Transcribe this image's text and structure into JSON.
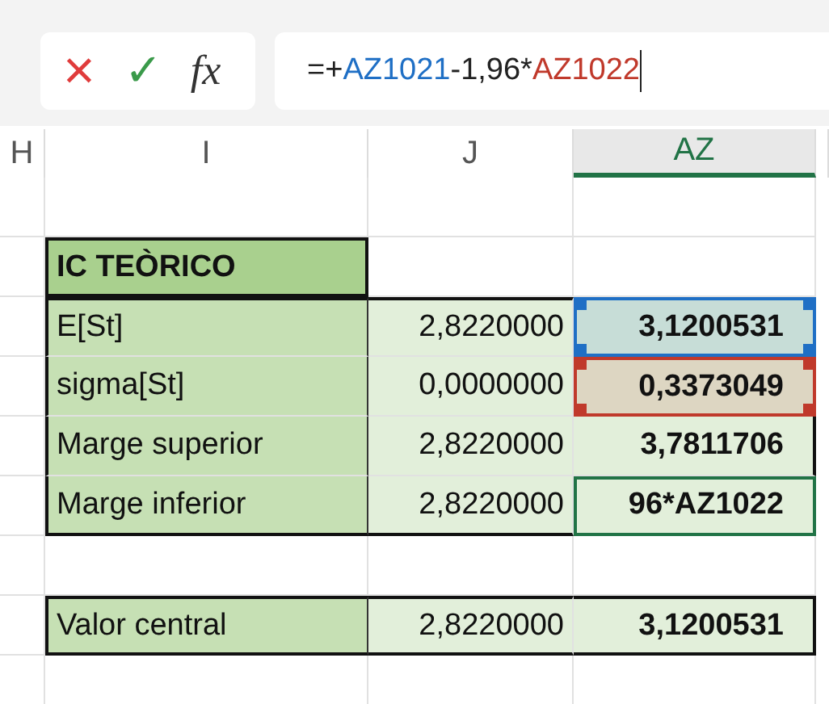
{
  "formula_bar": {
    "cancel": "×",
    "confirm": "✓",
    "function": "fx",
    "formula": [
      {
        "text": "=+"
      },
      {
        "text": "AZ1021",
        "color": "#1f6fc5"
      },
      {
        "text": "-1,96*"
      },
      {
        "text": "AZ1022",
        "color": "#c0392b"
      }
    ]
  },
  "columns": [
    {
      "label": "H",
      "selected": false
    },
    {
      "label": "I",
      "selected": false
    },
    {
      "label": "J",
      "selected": false
    },
    {
      "label": "AZ",
      "selected": true
    }
  ],
  "rows": [
    {
      "kind": "blank"
    },
    {
      "kind": "title",
      "label": "IC TEÒRICO"
    },
    {
      "kind": "data",
      "label": "E[St]",
      "j": "2,8220000",
      "az": "3,1200531",
      "color": "#1f6fc5",
      "active": false
    },
    {
      "kind": "data",
      "label": "sigma[St]",
      "j": "0,0000000",
      "az": "0,3373049",
      "color": "#c0392b",
      "active": false
    },
    {
      "kind": "data",
      "label": "Marge superior",
      "j": "2,8220000",
      "az": "3,7811706",
      "active": false
    },
    {
      "kind": "data",
      "label": "Marge inferior",
      "j": "2,8220000",
      "az": "96*AZ1022",
      "active": true
    },
    {
      "kind": "blank"
    },
    {
      "kind": "data",
      "label": "Valor central",
      "j": "2,8220000",
      "az": "3,1200531",
      "active": false
    },
    {
      "kind": "blank"
    }
  ]
}
